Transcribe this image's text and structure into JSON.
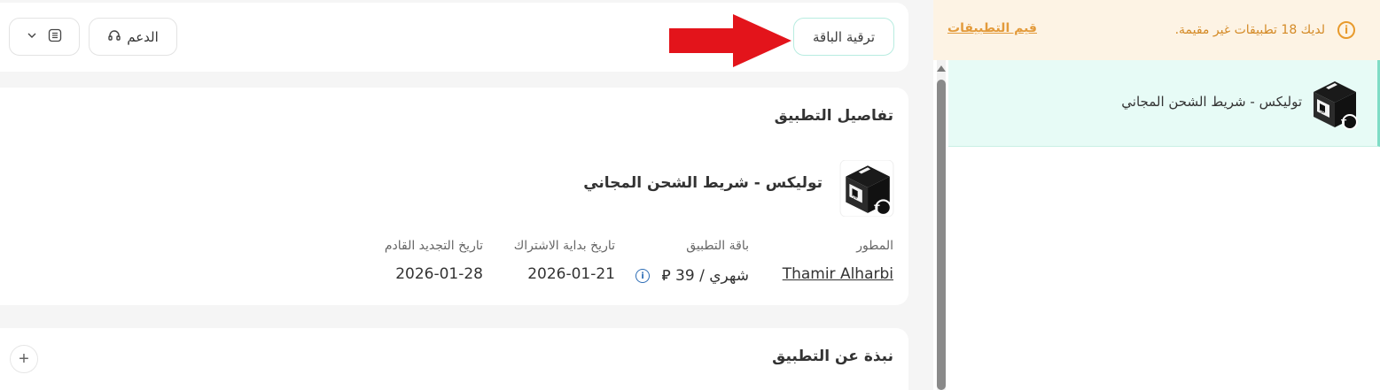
{
  "side_panel": {
    "notice": {
      "message": "لديك 18 تطبيقات غير مقيمة.",
      "link": "قيم التطبيقات",
      "icon": "info-icon",
      "color": "#e89a2c"
    },
    "selected_app": {
      "label": "توليكس - شريط الشحن المجاني",
      "icon": "app-box-icon"
    }
  },
  "toolbar": {
    "upgrade_label": "ترقية الباقة",
    "support_label": "الدعم",
    "support_icon": "headset-icon",
    "menu_icon": "list-icon",
    "dropdown_icon": "chevron-down-icon"
  },
  "annotation": {
    "arrow_color": "#e3141b",
    "arrow_direction": "points-right-to-upgrade-button"
  },
  "app_details": {
    "title": "تفاصيل التطبيق",
    "app_name": "توليكس - شريط الشحن المجاني",
    "fields": {
      "developer": {
        "label": "المطور",
        "value": "Thamir Alharbi"
      },
      "plan": {
        "label": "باقة التطبيق",
        "value": "شهري / 39 ⃁"
      },
      "start_date": {
        "label": "تاريخ بداية الاشتراك",
        "value": "2026-01-21"
      },
      "renewal_date": {
        "label": "تاريخ التجديد القادم",
        "value": "2026-01-28"
      }
    }
  },
  "about": {
    "title": "نبذة عن التطبيق",
    "expand_icon": "plus-icon"
  },
  "colors": {
    "accent": "#7fdcc6",
    "warning": "#e39a3a",
    "selected_bg": "#e7fbf6"
  }
}
